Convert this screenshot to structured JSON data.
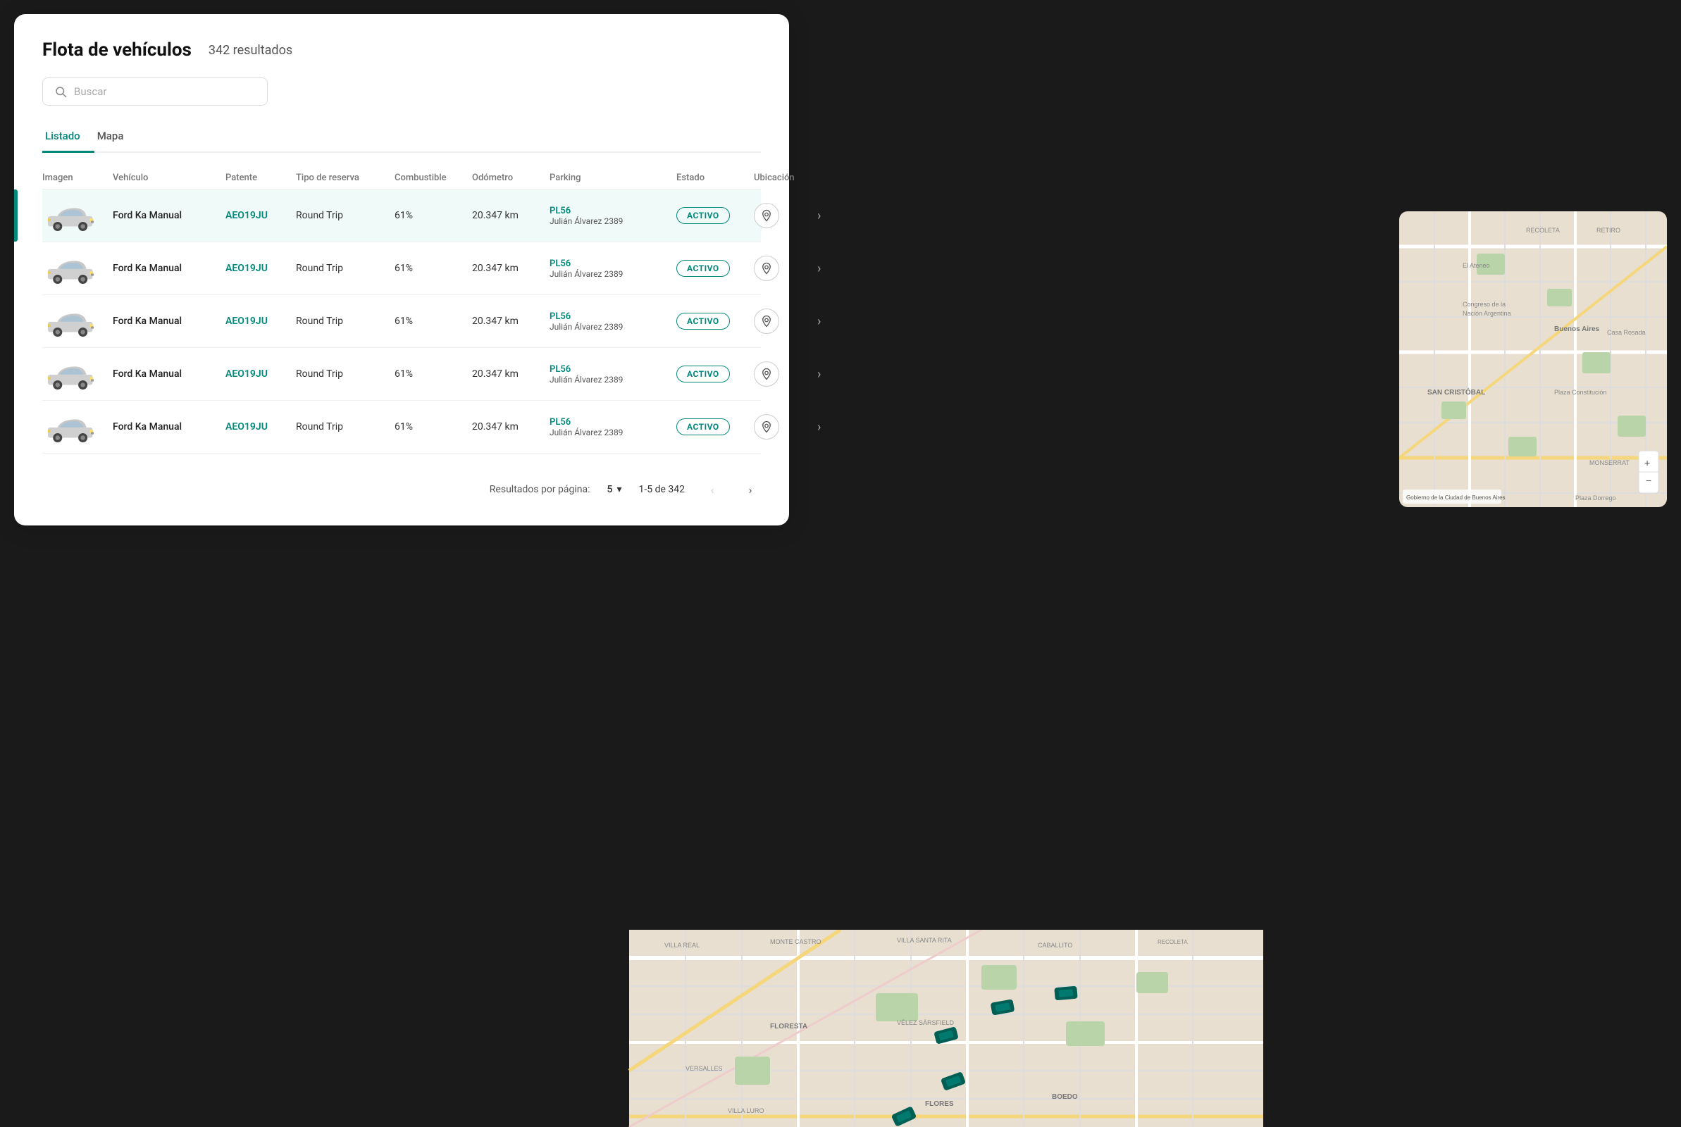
{
  "page": {
    "title": "Flota de vehículos",
    "results_count": "342 resultados"
  },
  "search": {
    "placeholder": "Buscar"
  },
  "tabs": [
    {
      "id": "listado",
      "label": "Listado",
      "active": true
    },
    {
      "id": "mapa",
      "label": "Mapa",
      "active": false
    }
  ],
  "table": {
    "columns": [
      "Imagen",
      "Vehículo",
      "Patente",
      "Tipo de reserva",
      "Combustible",
      "Odómetro",
      "Parking",
      "Estado",
      "Ubicación",
      ""
    ],
    "rows": [
      {
        "vehicle": "Ford Ka Manual",
        "patent": "AEO19JU",
        "trip_type": "Round Trip",
        "fuel": "61%",
        "odometer": "20.347 km",
        "parking_name": "PL56",
        "parking_address": "Julián Álvarez 2389",
        "status": "ACTIVO",
        "selected": true
      },
      {
        "vehicle": "Ford Ka Manual",
        "patent": "AEO19JU",
        "trip_type": "Round Trip",
        "fuel": "61%",
        "odometer": "20.347 km",
        "parking_name": "PL56",
        "parking_address": "Julián Álvarez 2389",
        "status": "ACTIVO",
        "selected": false
      },
      {
        "vehicle": "Ford Ka Manual",
        "patent": "AEO19JU",
        "trip_type": "Round Trip",
        "fuel": "61%",
        "odometer": "20.347 km",
        "parking_name": "PL56",
        "parking_address": "Julián Álvarez 2389",
        "status": "ACTIVO",
        "selected": false
      },
      {
        "vehicle": "Ford Ka Manual",
        "patent": "AEO19JU",
        "trip_type": "Round Trip",
        "fuel": "61%",
        "odometer": "20.347 km",
        "parking_name": "PL56",
        "parking_address": "Julián Álvarez 2389",
        "status": "ACTIVO",
        "selected": false
      },
      {
        "vehicle": "Ford Ka Manual",
        "patent": "AEO19JU",
        "trip_type": "Round Trip",
        "fuel": "61%",
        "odometer": "20.347 km",
        "parking_name": "PL56",
        "parking_address": "Julián Álvarez 2389",
        "status": "ACTIVO",
        "selected": false
      }
    ]
  },
  "pagination": {
    "per_page_label": "Resultados por página:",
    "per_page_value": "5",
    "range_label": "1-5 de 342"
  },
  "colors": {
    "accent": "#00897B",
    "badge_border": "#00897B",
    "selected_row_bg": "#f0faf9",
    "selected_indicator": "#00897B"
  }
}
